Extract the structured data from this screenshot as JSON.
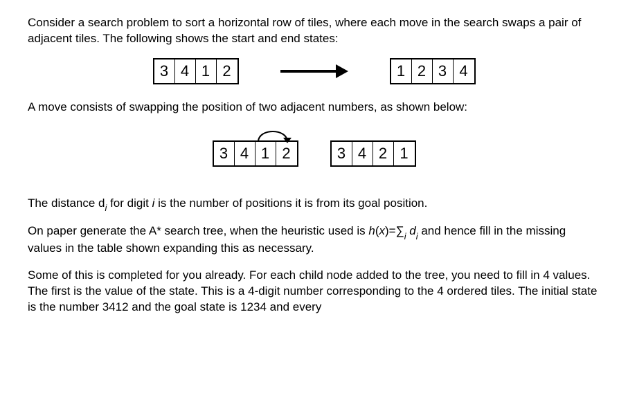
{
  "para1": "Consider a search problem to sort a horizontal row of tiles, where each move in the search swaps a pair of adjacent tiles. The following shows the start and end states:",
  "states": {
    "start": [
      "3",
      "4",
      "1",
      "2"
    ],
    "goal": [
      "1",
      "2",
      "3",
      "4"
    ]
  },
  "para2": "A move consists of swapping the position of two adjacent numbers, as shown below:",
  "swap_example": {
    "before": [
      "3",
      "4",
      "1",
      "2"
    ],
    "after": [
      "3",
      "4",
      "2",
      "1"
    ]
  },
  "para3_pre": "The distance d",
  "para3_sub": "i",
  "para3_mid": " for digit ",
  "para3_ital": "i",
  "para3_post": " is the number of positions it is from its goal position.",
  "para4_pre": "On paper generate the A* search tree, when the heuristic used is ",
  "para4_formula_h": "h",
  "para4_formula_paren_open": "(",
  "para4_formula_x": "x",
  "para4_formula_paren_close": ")=",
  "para4_formula_sum": "∑",
  "para4_formula_sumsub": "i",
  "para4_formula_d": " d",
  "para4_formula_dsub": "i",
  "para4_post": " and hence fill in the missing values in the table shown expanding this as necessary.",
  "para5": "Some of this is completed for you already. For each child node added to the tree, you need to fill in 4 values. The first is the value of the state. This is a 4-digit number corresponding to the 4 ordered tiles. The initial state is the number 3412 and the goal state is 1234 and every"
}
